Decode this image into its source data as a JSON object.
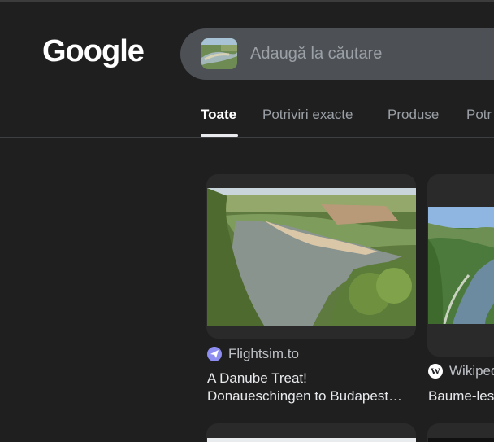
{
  "header": {
    "logo_text": "Google",
    "search": {
      "placeholder": "Adaugă la căutare"
    }
  },
  "tabs": [
    {
      "label": "Toate",
      "active": true
    },
    {
      "label": "Potriviri exacte",
      "active": false
    },
    {
      "label": "Produse",
      "active": false
    },
    {
      "label": "Potr",
      "active": false
    }
  ],
  "results": [
    {
      "source": "Flightsim.to",
      "title_line1": "A Danube Treat!",
      "title_line2": "Donaueschingen to Budapest…"
    },
    {
      "source": "Wikiped",
      "title_line1": "Baume-les"
    }
  ],
  "colors": {
    "background": "#1f1f1f",
    "search_bg": "#4d5156",
    "text_primary": "#e8eaed",
    "text_secondary": "#9aa0a6"
  }
}
